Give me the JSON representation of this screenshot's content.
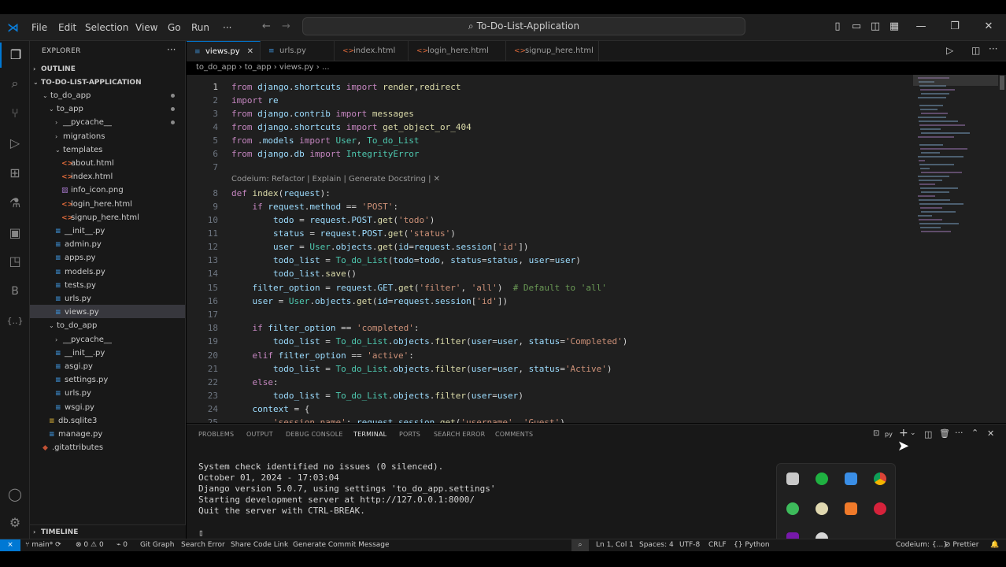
{
  "window": {
    "title": "To-Do-List-Application"
  },
  "menu": [
    "File",
    "Edit",
    "Selection",
    "View",
    "Go",
    "Run",
    "···"
  ],
  "sidebar": {
    "explorer_label": "EXPLORER",
    "outline_label": "OUTLINE",
    "project_label": "TO-DO-LIST-APPLICATION",
    "timeline_label": "TIMELINE",
    "tree": [
      {
        "label": "to_do_app",
        "depth": 1,
        "folder": true,
        "open": true,
        "modified": true
      },
      {
        "label": "to_app",
        "depth": 2,
        "folder": true,
        "open": true,
        "modified": true
      },
      {
        "label": "__pycache__",
        "depth": 3,
        "folder": true,
        "open": false,
        "modified": true
      },
      {
        "label": "migrations",
        "depth": 3,
        "folder": true,
        "open": false
      },
      {
        "label": "templates",
        "depth": 3,
        "folder": true,
        "open": true
      },
      {
        "label": "about.html",
        "depth": 4,
        "icon": "html"
      },
      {
        "label": "index.html",
        "depth": 4,
        "icon": "html"
      },
      {
        "label": "info_icon.png",
        "depth": 4,
        "icon": "img"
      },
      {
        "label": "login_here.html",
        "depth": 4,
        "icon": "html"
      },
      {
        "label": "signup_here.html",
        "depth": 4,
        "icon": "html"
      },
      {
        "label": "__init__.py",
        "depth": 3,
        "icon": "py"
      },
      {
        "label": "admin.py",
        "depth": 3,
        "icon": "py"
      },
      {
        "label": "apps.py",
        "depth": 3,
        "icon": "py"
      },
      {
        "label": "models.py",
        "depth": 3,
        "icon": "py"
      },
      {
        "label": "tests.py",
        "depth": 3,
        "icon": "py"
      },
      {
        "label": "urls.py",
        "depth": 3,
        "icon": "py"
      },
      {
        "label": "views.py",
        "depth": 3,
        "icon": "py",
        "selected": true
      },
      {
        "label": "to_do_app",
        "depth": 2,
        "folder": true,
        "open": true
      },
      {
        "label": "__pycache__",
        "depth": 3,
        "folder": true,
        "open": false
      },
      {
        "label": "__init__.py",
        "depth": 3,
        "icon": "py"
      },
      {
        "label": "asgi.py",
        "depth": 3,
        "icon": "py"
      },
      {
        "label": "settings.py",
        "depth": 3,
        "icon": "py"
      },
      {
        "label": "urls.py",
        "depth": 3,
        "icon": "py"
      },
      {
        "label": "wsgi.py",
        "depth": 3,
        "icon": "py"
      },
      {
        "label": "db.sqlite3",
        "depth": 2,
        "icon": "db"
      },
      {
        "label": "manage.py",
        "depth": 2,
        "icon": "py"
      },
      {
        "label": ".gitattributes",
        "depth": 1,
        "icon": "git"
      }
    ]
  },
  "tabs": [
    {
      "label": "views.py",
      "icon": "py",
      "active": true
    },
    {
      "label": "urls.py",
      "icon": "py"
    },
    {
      "label": "index.html",
      "icon": "html"
    },
    {
      "label": "login_here.html",
      "icon": "html"
    },
    {
      "label": "signup_here.html",
      "icon": "html"
    }
  ],
  "breadcrumb": [
    "to_do_app",
    "to_app",
    "views.py",
    "..."
  ],
  "codelens": "Codeium: Refactor | Explain | Generate Docstring | ✕",
  "code": [
    {
      "n": "1",
      "text": "from django.shortcuts import render,redirect"
    },
    {
      "n": "2",
      "text": "import re"
    },
    {
      "n": "3",
      "text": "from django.contrib import messages"
    },
    {
      "n": "4",
      "text": "from django.shortcuts import get_object_or_404"
    },
    {
      "n": "5",
      "text": "from .models import User, To_do_List"
    },
    {
      "n": "6",
      "text": "from django.db import IntegrityError"
    },
    {
      "n": "7",
      "text": ""
    },
    {
      "n": "8",
      "text": "def index(request):"
    },
    {
      "n": "9",
      "text": "    if request.method == 'POST':"
    },
    {
      "n": "10",
      "text": "        todo = request.POST.get('todo')"
    },
    {
      "n": "11",
      "text": "        status = request.POST.get('status')"
    },
    {
      "n": "12",
      "text": "        user = User.objects.get(id=request.session['id'])"
    },
    {
      "n": "13",
      "text": "        todo_list = To_do_List(todo=todo, status=status, user=user)"
    },
    {
      "n": "14",
      "text": "        todo_list.save()"
    },
    {
      "n": "15",
      "text": "    filter_option = request.GET.get('filter', 'all')  # Default to 'all'"
    },
    {
      "n": "16",
      "text": "    user = User.objects.get(id=request.session['id'])"
    },
    {
      "n": "17",
      "text": ""
    },
    {
      "n": "18",
      "text": "    if filter_option == 'completed':"
    },
    {
      "n": "19",
      "text": "        todo_list = To_do_List.objects.filter(user=user, status='Completed')"
    },
    {
      "n": "20",
      "text": "    elif filter_option == 'active':"
    },
    {
      "n": "21",
      "text": "        todo_list = To_do_List.objects.filter(user=user, status='Active')"
    },
    {
      "n": "22",
      "text": "    else:"
    },
    {
      "n": "23",
      "text": "        todo_list = To_do_List.objects.filter(user=user)"
    },
    {
      "n": "24",
      "text": "    context = {"
    },
    {
      "n": "25",
      "text": "        'session_name': request.session.get('username', 'Guest'),"
    }
  ],
  "panel_tabs": [
    {
      "label": "PROBLEMS"
    },
    {
      "label": "OUTPUT"
    },
    {
      "label": "DEBUG CONSOLE"
    },
    {
      "label": "TERMINAL",
      "active": true
    },
    {
      "label": "PORTS"
    },
    {
      "label": "SEARCH ERROR"
    },
    {
      "label": "COMMENTS"
    }
  ],
  "panel_shell_label": "py",
  "terminal": [
    "System check identified no issues (0 silenced).",
    "October 01, 2024 - 17:03:04",
    "Django version 5.0.7, using settings 'to_do_app.settings'",
    "Starting development server at http://127.0.0.1:8000/",
    "Quit the server with CTRL-BREAK.",
    "",
    "▯"
  ],
  "statusbar": {
    "branch": "main*",
    "errors": "0",
    "warnings": "0",
    "ports": "0",
    "git_graph": "Git Graph",
    "search_error": "Search Error",
    "share_code": "Share Code Link",
    "commit_msg": "Generate Commit Message",
    "position": "Ln 1, Col 1",
    "spaces": "Spaces: 4",
    "encoding": "UTF-8",
    "eol": "CRLF",
    "language": "Python",
    "codeium": "Codeium: {...}",
    "prettier": "Prettier"
  },
  "colors": {
    "accent": "#0078d4",
    "keyword": "#c586c0",
    "string": "#ce9178",
    "function": "#dcdcaa",
    "class": "#4ec9b0",
    "variable": "#9cdcfe",
    "comment": "#6a9955"
  }
}
